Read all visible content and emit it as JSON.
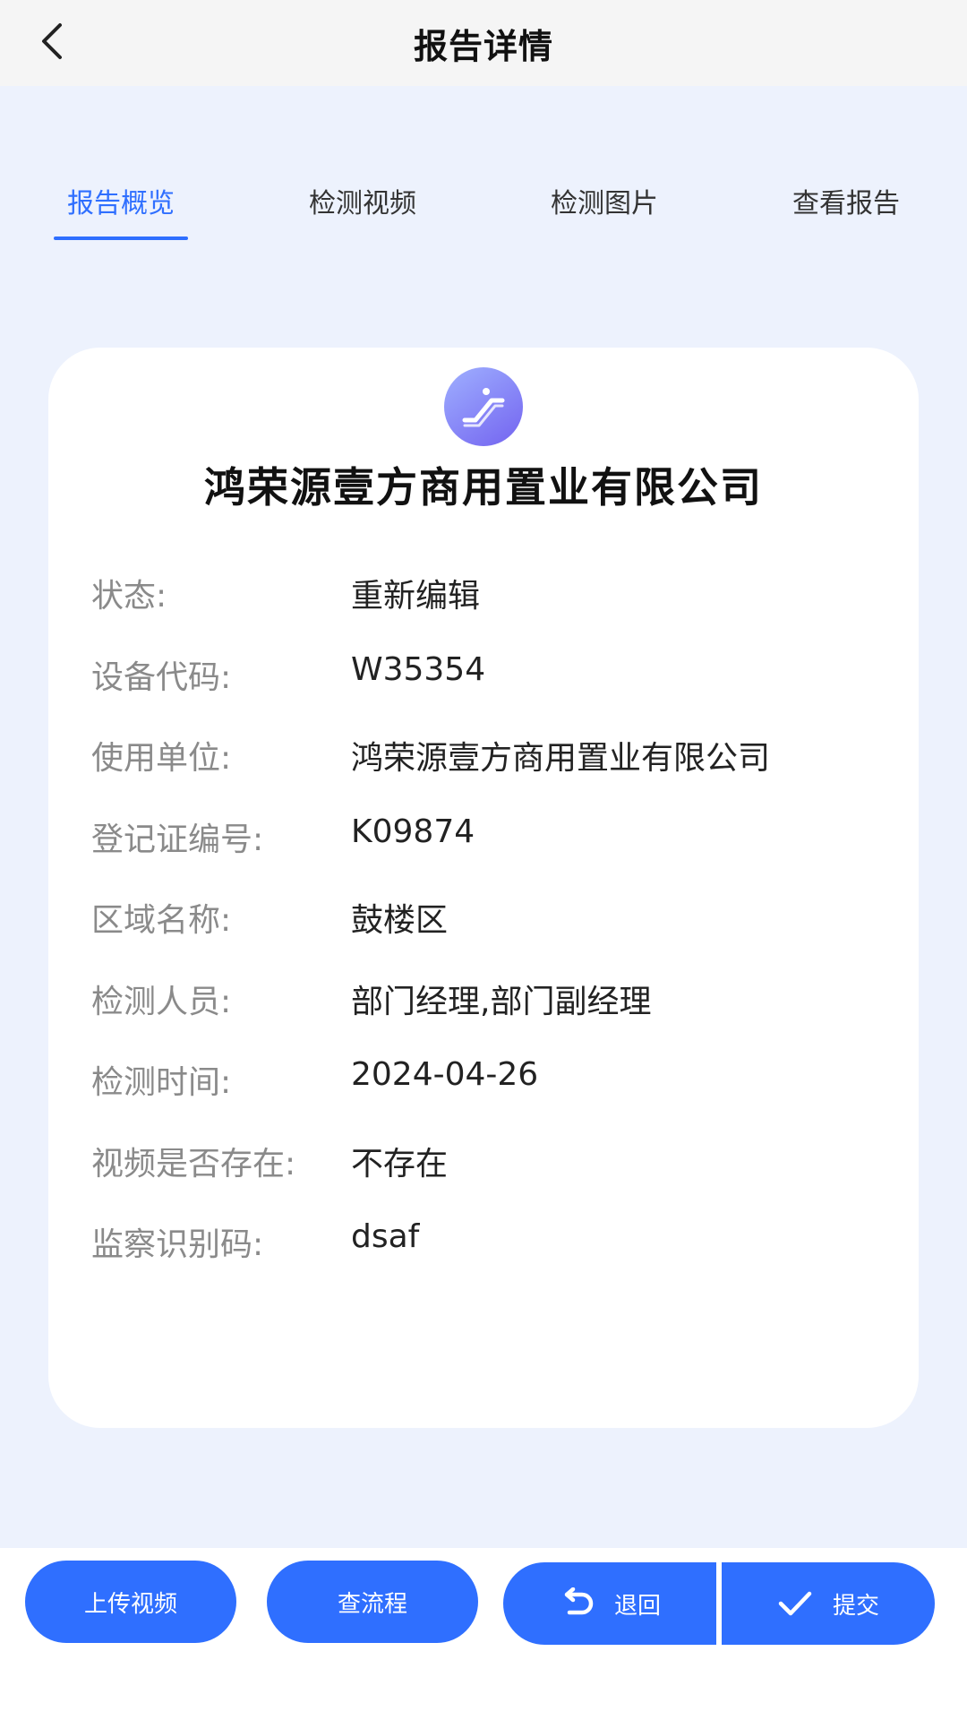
{
  "header": {
    "title": "报告详情",
    "back_icon": "chevron-left-icon"
  },
  "tabs": [
    {
      "label": "报告概览",
      "active": true
    },
    {
      "label": "检测视频",
      "active": false
    },
    {
      "label": "检测图片",
      "active": false
    },
    {
      "label": "查看报告",
      "active": false
    }
  ],
  "card": {
    "icon": "escalator-icon",
    "company": "鸿荣源壹方商用置业有限公司",
    "fields": [
      {
        "label": "状态:",
        "value": "重新编辑"
      },
      {
        "label": "设备代码:",
        "value": "W35354"
      },
      {
        "label": "使用单位:",
        "value": "鸿荣源壹方商用置业有限公司"
      },
      {
        "label": "登记证编号:",
        "value": "K09874"
      },
      {
        "label": "区域名称:",
        "value": "鼓楼区"
      },
      {
        "label": "检测人员:",
        "value": "部门经理,部门副经理"
      },
      {
        "label": "检测时间:",
        "value": "2024-04-26"
      },
      {
        "label": "视频是否存在:",
        "value": "不存在"
      },
      {
        "label": "监察识别码:",
        "value": "dsaf"
      }
    ]
  },
  "actions": {
    "upload_video": "上传视频",
    "view_flow": "查流程",
    "reject": "退回",
    "submit": "提交"
  },
  "colors": {
    "accent": "#2f6fff",
    "background": "#edf2fd",
    "header_bg": "#f5f5f5",
    "label_gray": "#8a8a8a"
  }
}
